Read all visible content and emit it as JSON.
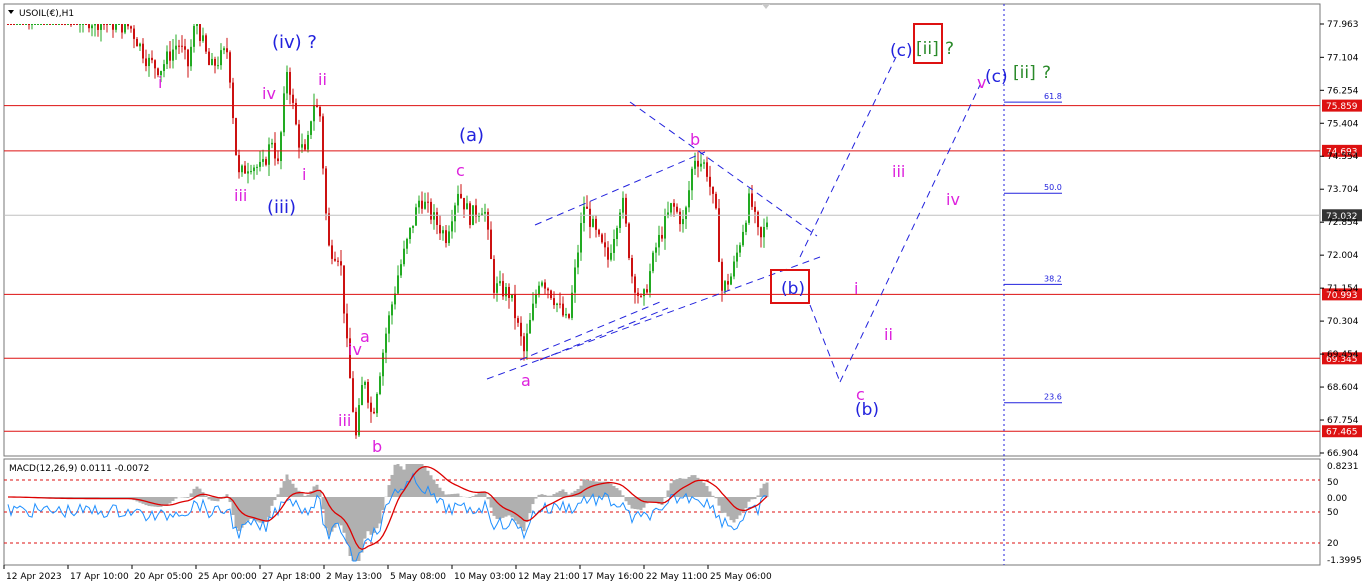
{
  "window": {
    "title": "USOIL(€),H1"
  },
  "colors": {
    "bull": "#22aa22",
    "bear": "#cc1111",
    "level_line": "#dd1111",
    "level_label_bg": "#dd1111",
    "current_label_bg": "#333333",
    "wave_magenta": "#dd22dd",
    "wave_blue": "#2222dd",
    "wave_green": "#2a8a2a",
    "macd_hist": "#b0b0b0",
    "macd_signal": "#dd0000",
    "macd_line": "#1e8fff",
    "dash_blue": "#2222dd"
  },
  "price_axis": {
    "min": 66.904,
    "max": 77.963,
    "ticks": [
      "77.963",
      "77.104",
      "76.254",
      "75.404",
      "74.554",
      "73.704",
      "72.854",
      "72.004",
      "71.154",
      "70.304",
      "69.454",
      "68.604",
      "67.754",
      "66.904"
    ]
  },
  "levels": [
    {
      "price": 75.859,
      "label": "75.859"
    },
    {
      "price": 74.693,
      "label": "74.693"
    },
    {
      "price": 70.993,
      "label": "70.993"
    },
    {
      "price": 69.345,
      "label": "69.345"
    },
    {
      "price": 67.465,
      "label": "67.465"
    }
  ],
  "current_price": {
    "price": 73.032,
    "label": "73.032"
  },
  "fib_levels": [
    {
      "label": "61.8",
      "price": 75.95
    },
    {
      "label": "50.0",
      "price": 73.6
    },
    {
      "label": "38.2",
      "price": 71.25
    },
    {
      "label": "23.6",
      "price": 68.2
    }
  ],
  "time_axis": {
    "labels": [
      "12 Apr 2023",
      "17 Apr 10:00",
      "20 Apr 05:00",
      "25 Apr 00:00",
      "27 Apr 18:00",
      "2 May 13:00",
      "5 May 08:00",
      "10 May 03:00",
      "12 May 21:00",
      "17 May 16:00",
      "22 May 11:00",
      "25 May 06:00"
    ]
  },
  "wave_labels": [
    {
      "text": "i",
      "color": "magenta",
      "size": 16
    },
    {
      "text": "(iv) ?",
      "color": "blue",
      "size": 18
    },
    {
      "text": "iv",
      "color": "magenta",
      "size": 16
    },
    {
      "text": "ii",
      "color": "magenta",
      "size": 16
    },
    {
      "text": "iii",
      "color": "magenta",
      "size": 16
    },
    {
      "text": "(iii)",
      "color": "blue",
      "size": 18
    },
    {
      "text": "i",
      "color": "magenta",
      "size": 16
    },
    {
      "text": "(a)",
      "color": "blue",
      "size": 18
    },
    {
      "text": "c",
      "color": "magenta",
      "size": 16
    },
    {
      "text": "b",
      "color": "magenta",
      "size": 16
    },
    {
      "text": "a",
      "color": "magenta",
      "size": 16
    },
    {
      "text": "iv",
      "color": "magenta",
      "size": 16
    },
    {
      "text": "iii",
      "color": "magenta",
      "size": 16
    },
    {
      "text": "b",
      "color": "magenta",
      "size": 16
    },
    {
      "text": "a",
      "color": "magenta",
      "size": 16
    },
    {
      "text": "(b)",
      "color": "blue",
      "size": 17
    },
    {
      "text": "i",
      "color": "magenta",
      "size": 16
    },
    {
      "text": "ii",
      "color": "magenta",
      "size": 16
    },
    {
      "text": "iii",
      "color": "magenta",
      "size": 16
    },
    {
      "text": "iv",
      "color": "magenta",
      "size": 16
    },
    {
      "text": "v",
      "color": "magenta",
      "size": 16
    },
    {
      "text": "c",
      "color": "magenta",
      "size": 16
    },
    {
      "text": "(b)",
      "color": "blue",
      "size": 17
    },
    {
      "text": "(c)",
      "color": "blue",
      "size": 17
    },
    {
      "text": "(c)",
      "color": "blue",
      "size": 17
    }
  ],
  "wave_boxes": {
    "top_box": {
      "inner": "[ii]",
      "suffix": "?"
    },
    "right": {
      "inner": "[ii]",
      "suffix": "?"
    }
  },
  "macd": {
    "title": "MACD(12,26,9) 0.0111 -0.0072",
    "axis_labels": [
      "0.8231",
      "50",
      "0.00",
      "50",
      "20",
      "-1.3995"
    ]
  },
  "chart_data": {
    "type": "line",
    "title": "USOIL(€),H1",
    "xlabel": "",
    "ylabel": "",
    "ylim": [
      66.904,
      77.963
    ],
    "x": [
      "12 Apr 2023",
      "17 Apr 10:00",
      "20 Apr 05:00",
      "25 Apr 00:00",
      "27 Apr 18:00",
      "2 May 13:00",
      "5 May 08:00",
      "10 May 03:00",
      "12 May 21:00",
      "17 May 16:00",
      "22 May 11:00",
      "25 May 06:00"
    ],
    "series": [
      {
        "values": [
          77.9,
          76.9,
          76.8,
          74.0,
          76.8,
          67.3,
          73.5,
          73.7,
          69.5,
          73.0,
          74.55,
          73.0
        ]
      }
    ],
    "grid": false
  }
}
